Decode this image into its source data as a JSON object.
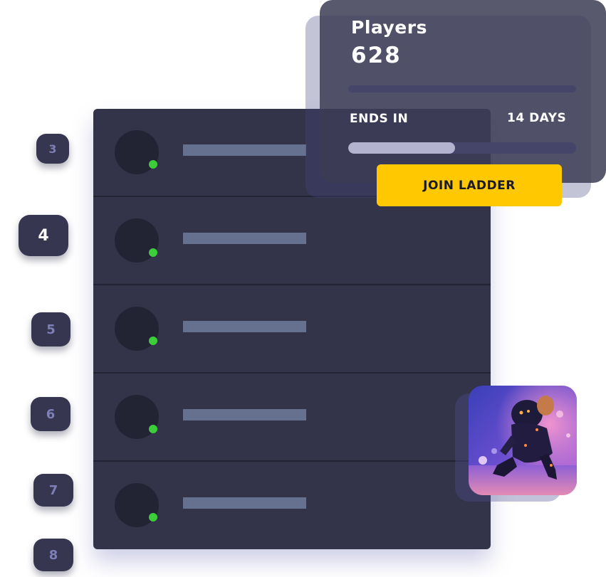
{
  "leaderboard": {
    "ranks": [
      "3",
      "4",
      "5",
      "6",
      "7",
      "8"
    ],
    "active_rank": "4",
    "status_color": "#3dcc3a"
  },
  "players_card": {
    "title": "Players",
    "count": "628",
    "ends_label": "ENDS IN",
    "ends_value": "14 DAYS",
    "time_progress": 0.47,
    "join_label": "JOIN LADDER",
    "join_color": "#ffc800"
  },
  "thumbnail": {
    "icon": "game-art-robot-icon"
  }
}
